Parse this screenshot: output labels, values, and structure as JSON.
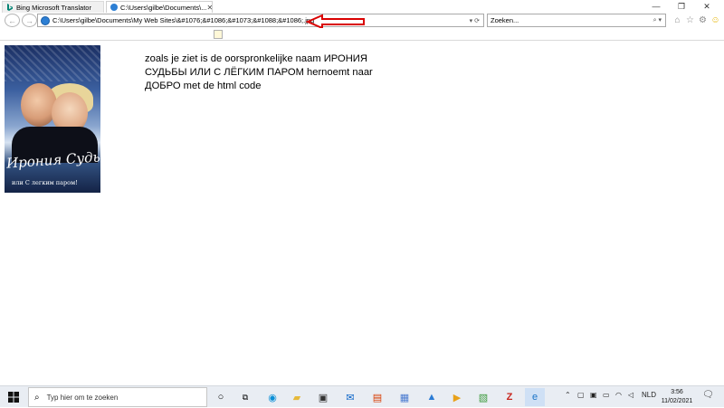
{
  "window": {
    "minimize_glyph": "—",
    "restore_glyph": "❐",
    "close_glyph": "✕"
  },
  "nav": {
    "address": "C:\\Users\\gilbe\\Documents\\My Web Sites\\&#1076;&#1086;&#1073;&#1088;&#1086;.jpg",
    "address_controls": "▾ ⟳",
    "search_placeholder": "Zoeken...",
    "search_controls": "⌕ ▾"
  },
  "tabs": [
    {
      "label": "Bing Microsoft Translator"
    },
    {
      "label": "C:\\Users\\gilbe\\Documents\\...",
      "close": "✕"
    }
  ],
  "content": {
    "poster_title": "Ирония Судьбы.",
    "poster_subtitle": "или С легким паром!",
    "text": "zoals je ziet is de oorspronkelijke naam ИРОНИЯ СУДЬБЫ ИЛИ С ЛЁГКИМ ПАРОМ hernoemt naar ДОБРО met de html code"
  },
  "taskbar": {
    "search_placeholder": "Typ hier om te zoeken",
    "language": "NLD",
    "time": "3:56",
    "date": "11/02/2021"
  },
  "colors": {
    "arrow": "#d90000",
    "taskbar": "#e9edf3",
    "accent": "#0078d7"
  }
}
